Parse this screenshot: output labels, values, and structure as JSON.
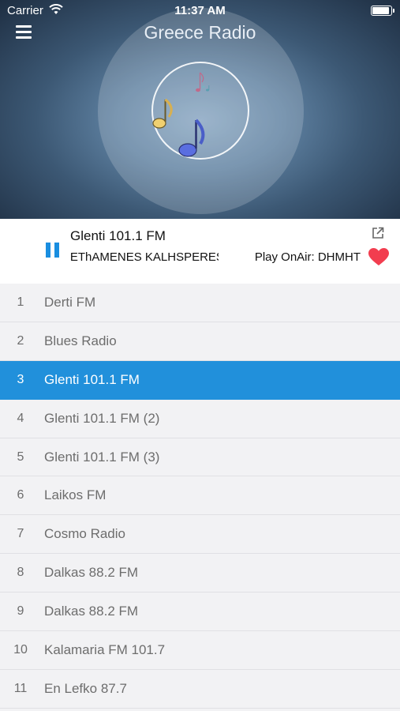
{
  "status_bar": {
    "carrier": "Carrier",
    "time": "11:37 AM",
    "battery_level": 1.0
  },
  "header": {
    "title": "Greece Radio"
  },
  "player": {
    "station": "Glenti 101.1 FM",
    "track": "'EThAMENES KALHSPERES",
    "onair": "Play OnAir: DHMHT",
    "state": "playing"
  },
  "colors": {
    "accent": "#2190db",
    "favorite": "#f23d4f"
  },
  "stations": [
    {
      "num": "1",
      "name": "Derti FM",
      "selected": false
    },
    {
      "num": "2",
      "name": "Blues Radio",
      "selected": false
    },
    {
      "num": "3",
      "name": "Glenti 101.1 FM",
      "selected": true
    },
    {
      "num": "4",
      "name": "Glenti 101.1 FM (2)",
      "selected": false
    },
    {
      "num": "5",
      "name": "Glenti 101.1 FM (3)",
      "selected": false
    },
    {
      "num": "6",
      "name": "Laikos FM",
      "selected": false
    },
    {
      "num": "7",
      "name": "Cosmo Radio",
      "selected": false
    },
    {
      "num": "8",
      "name": "Dalkas 88.2 FM",
      "selected": false
    },
    {
      "num": "9",
      "name": "Dalkas 88.2 FM",
      "selected": false
    },
    {
      "num": "10",
      "name": "Kalamaria FM 101.7",
      "selected": false
    },
    {
      "num": "11",
      "name": "En Lefko 87.7",
      "selected": false
    }
  ]
}
